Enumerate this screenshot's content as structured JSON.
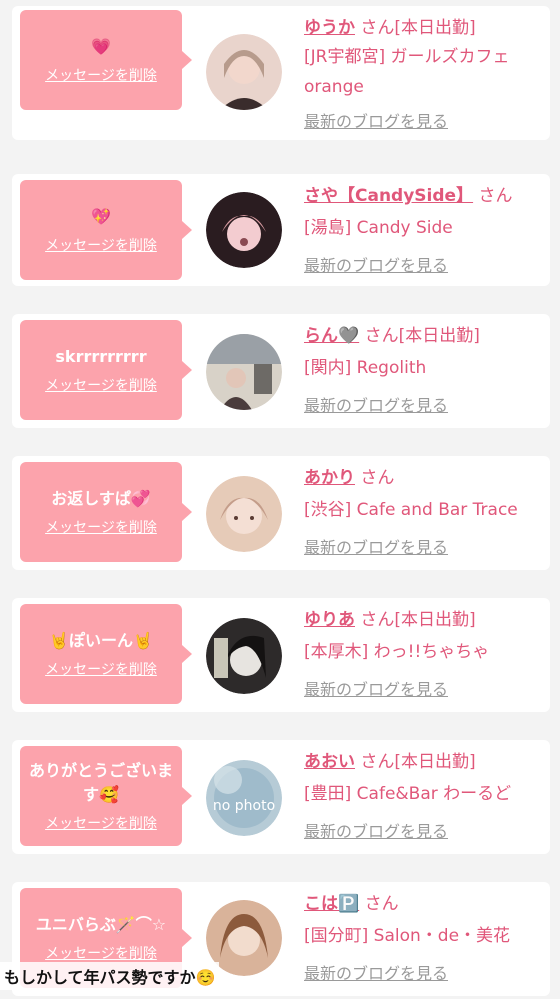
{
  "entries": [
    {
      "message": "💗",
      "delete_label": "メッセージを削除",
      "name": "ゆうか",
      "san": "さん",
      "status": "[本日出勤]",
      "shop": "[JR宇都宮] ガールズカフェorange",
      "blog_link": "最新のブログを見る",
      "avatar_colors": [
        "#e9d4cc",
        "#3a2c2c",
        "#f2d7cc"
      ]
    },
    {
      "message": "💖",
      "delete_label": "メッセージを削除",
      "name": "さや【CandySide】",
      "san": "さん",
      "status": "",
      "shop": "[湯島] Candy Side",
      "blog_link": "最新のブログを見る",
      "avatar_colors": [
        "#2a1c20",
        "#d69aa0",
        "#f3ccd0"
      ]
    },
    {
      "message": "skrrrrrrrrr",
      "delete_label": "メッセージを削除",
      "name": "らん🩶",
      "san": "さん",
      "status": "[本日出勤]",
      "shop": "[関内] Regolith",
      "blog_link": "最新のブログを見る",
      "avatar_colors": [
        "#9aa0a6",
        "#4a3c3c",
        "#d8d2c8"
      ]
    },
    {
      "message": "お返しすぱ💞",
      "delete_label": "メッセージを削除",
      "name": "あかり",
      "san": "さん",
      "status": "",
      "shop": "[渋谷] Cafe and Bar Trace",
      "blog_link": "最新のブログを見る",
      "avatar_colors": [
        "#e6cbb8",
        "#c49d8a",
        "#f4dfd4"
      ]
    },
    {
      "message": "🤘ぽいーん🤘",
      "delete_label": "メッセージを削除",
      "name": "ゆりあ",
      "san": "さん",
      "status": "[本日出勤]",
      "shop": "[本厚木] わっ!!ちゃちゃ",
      "blog_link": "最新のブログを見る",
      "avatar_colors": [
        "#2d2a2a",
        "#c9c6b8",
        "#e7e4e0"
      ]
    },
    {
      "message": "ありがとうございます🥰",
      "delete_label": "メッセージを削除",
      "name": "あおい",
      "san": "さん",
      "status": "[本日出勤]",
      "shop": "[豊田] Cafe&Bar わーるど",
      "blog_link": "最新のブログを見る",
      "avatar_colors": [
        "#8fb1c3",
        "#b6cbd6",
        "#d5e2e8"
      ],
      "avatar_text": "no photo"
    },
    {
      "message": "ユニバらぶ🪄⌒☆",
      "delete_label": "メッセージを削除",
      "name": "こは🅿️",
      "san": "さん",
      "status": "",
      "shop": "[国分町] Salon・de・美花",
      "blog_link": "最新のブログを見る",
      "avatar_colors": [
        "#d9b39a",
        "#8c5a3c",
        "#f2dccd"
      ]
    }
  ],
  "footer_text": "もしかして年パス勢ですか☺️"
}
